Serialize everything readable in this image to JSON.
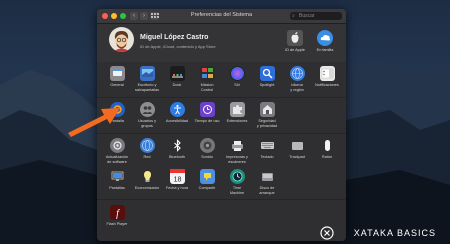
{
  "window": {
    "title": "Preferencias del Sistema",
    "search_placeholder": "Buscar"
  },
  "user": {
    "name": "Miguel López Castro",
    "subtitle": "ID de Apple, iCloud, contenido y App Store"
  },
  "account_items": [
    {
      "label": "ID de Apple",
      "icon": "apple-id-icon"
    },
    {
      "label": "En familia",
      "icon": "family-sharing-icon"
    }
  ],
  "rows": [
    [
      {
        "l1": "General",
        "l2": "",
        "icon": "general-icon"
      },
      {
        "l1": "Escritorio y",
        "l2": "salvapantallas",
        "icon": "desktop-icon"
      },
      {
        "l1": "Dock",
        "l2": "",
        "icon": "dock-icon"
      },
      {
        "l1": "Mission",
        "l2": "Control",
        "icon": "mission-control-icon"
      },
      {
        "l1": "Siri",
        "l2": "",
        "icon": "siri-icon"
      },
      {
        "l1": "Spotlight",
        "l2": "",
        "icon": "spotlight-icon"
      },
      {
        "l1": "Idioma",
        "l2": "y región",
        "icon": "language-icon"
      },
      {
        "l1": "Notificaciones",
        "l2": "",
        "icon": "notifications-icon"
      }
    ],
    [
      {
        "l1": "Pantalla",
        "l2": "",
        "icon": "screen-icon"
      },
      {
        "l1": "Usuarios y",
        "l2": "grupos",
        "icon": "users-groups-icon"
      },
      {
        "l1": "Accesibilidad",
        "l2": "",
        "icon": "accessibility-icon"
      },
      {
        "l1": "Tiempo de uso",
        "l2": "",
        "icon": "screen-time-icon"
      },
      {
        "l1": "Extensiones",
        "l2": "",
        "icon": "extensions-icon"
      },
      {
        "l1": "Seguridad",
        "l2": "y privacidad",
        "icon": "security-icon"
      }
    ],
    [
      {
        "l1": "Actualización",
        "l2": "de software",
        "icon": "software-update-icon"
      },
      {
        "l1": "Red",
        "l2": "",
        "icon": "network-icon"
      },
      {
        "l1": "Bluetooth",
        "l2": "",
        "icon": "bluetooth-icon"
      },
      {
        "l1": "Sonido",
        "l2": "",
        "icon": "sound-icon"
      },
      {
        "l1": "Impresoras y",
        "l2": "escáneres",
        "icon": "printers-icon"
      },
      {
        "l1": "Teclado",
        "l2": "",
        "icon": "keyboard-icon"
      },
      {
        "l1": "Trackpad",
        "l2": "",
        "icon": "trackpad-icon"
      },
      {
        "l1": "Ratón",
        "l2": "",
        "icon": "mouse-icon"
      }
    ],
    [
      {
        "l1": "Pantallas",
        "l2": "",
        "icon": "displays-icon"
      },
      {
        "l1": "Economizador",
        "l2": "",
        "icon": "energy-saver-icon"
      },
      {
        "l1": "Fecha y hora",
        "l2": "",
        "icon": "date-time-icon"
      },
      {
        "l1": "Compartir",
        "l2": "",
        "icon": "sharing-icon"
      },
      {
        "l1": "Time",
        "l2": "Machine",
        "icon": "time-machine-icon"
      },
      {
        "l1": "Disco de",
        "l2": "arranque",
        "icon": "startup-disk-icon"
      }
    ],
    [
      {
        "l1": "Flash Player",
        "l2": "",
        "icon": "flash-player-icon"
      }
    ]
  ],
  "brand": {
    "text": "XATAKA BASICS"
  }
}
